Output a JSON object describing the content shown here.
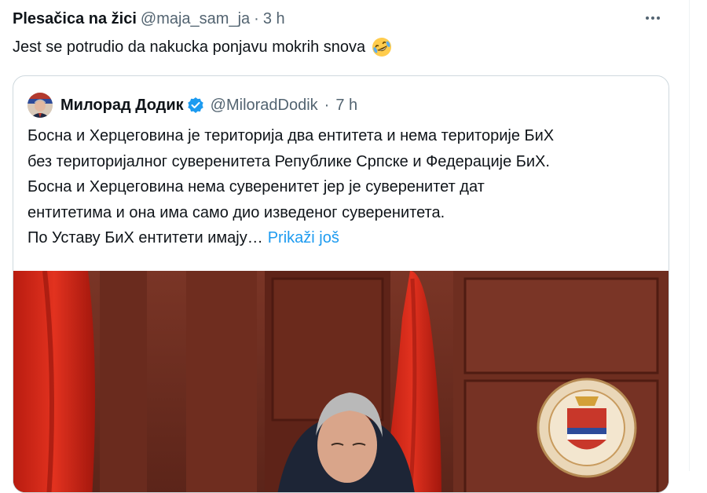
{
  "tweet": {
    "author_name": "Plesačica na žici",
    "handle": "@maja_sam_ja",
    "separator": "·",
    "time": "3 h",
    "text": "Jest se potrudio da nakucka ponjavu  mokrih snova",
    "emoji_icon": "rofl-emoji-icon",
    "more_icon": "more-options-icon"
  },
  "quote": {
    "author_name": "Милорад Додик",
    "verified_icon": "verified-badge-icon",
    "handle": "@MiloradDodik",
    "separator": "·",
    "time": "7 h",
    "lines": [
      "Босна и Херцеговина је територија два ентитета и нема територије БиХ",
      "без територијалног суверенитета Републике Српске и Федерације БиХ.",
      "Босна и Херцеговина нема суверенитет јер је суверенитет дат",
      "ентитетима и она има само дио изведеног суверенитета.",
      "По Уставу БиХ ентитети имају…"
    ],
    "show_more": "Prikaži još",
    "photo_description_icon": "photo-with-flags-and-coat-of-arms"
  },
  "colors": {
    "text_primary": "#0f1419",
    "text_secondary": "#536471",
    "link": "#1d9bf0",
    "border": "#cfd9de",
    "verified": "#1d9bf0"
  }
}
